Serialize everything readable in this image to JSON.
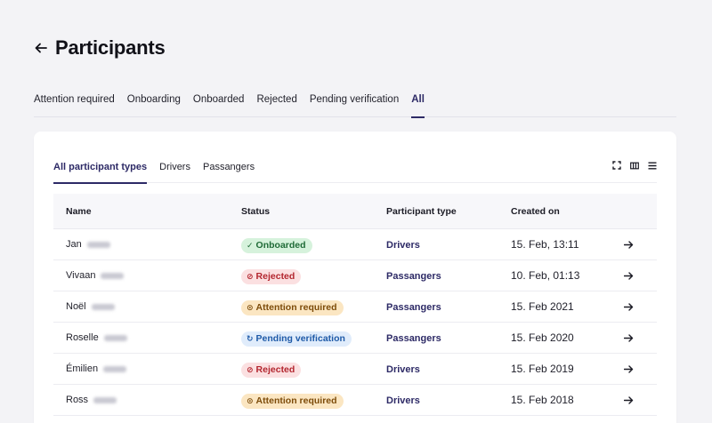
{
  "page": {
    "title": "Participants"
  },
  "tabs": [
    {
      "label": "Attention required",
      "active": false
    },
    {
      "label": "Onboarding",
      "active": false
    },
    {
      "label": "Onboarded",
      "active": false
    },
    {
      "label": "Rejected",
      "active": false
    },
    {
      "label": "Pending verification",
      "active": false
    },
    {
      "label": "All",
      "active": true
    }
  ],
  "subtabs": [
    {
      "label": "All participant types",
      "active": true
    },
    {
      "label": "Drivers",
      "active": false
    },
    {
      "label": "Passangers",
      "active": false
    }
  ],
  "toolbar_icons": [
    "fullscreen-icon",
    "columns-icon",
    "density-icon"
  ],
  "table": {
    "columns": [
      "Name",
      "Status",
      "Participant type",
      "Created on"
    ],
    "rows": [
      {
        "first_name": "Jan",
        "status": "Onboarded",
        "status_kind": "green",
        "status_icon": "✓",
        "type": "Drivers",
        "created": "15. Feb, 13:11"
      },
      {
        "first_name": "Vivaan",
        "status": "Rejected",
        "status_kind": "red",
        "status_icon": "⊘",
        "type": "Passangers",
        "created": "10. Feb, 01:13"
      },
      {
        "first_name": "Noël",
        "status": "Attention required",
        "status_kind": "amber",
        "status_icon": "⊙",
        "type": "Passangers",
        "created": "15. Feb 2021"
      },
      {
        "first_name": "Roselle",
        "status": "Pending verification",
        "status_kind": "blue",
        "status_icon": "↻",
        "type": "Passangers",
        "created": "15. Feb 2020"
      },
      {
        "first_name": "Émilien",
        "status": "Rejected",
        "status_kind": "red",
        "status_icon": "⊘",
        "type": "Drivers",
        "created": "15. Feb 2019"
      },
      {
        "first_name": "Ross",
        "status": "Attention required",
        "status_kind": "amber",
        "status_icon": "⊙",
        "type": "Drivers",
        "created": "15. Feb 2018"
      }
    ]
  },
  "colors": {
    "accent": "#2d2a66",
    "page_bg": "#f3f3f6",
    "onboarded": "#d6f2dc",
    "rejected": "#fbe0e1",
    "attention": "#fbe6c2",
    "pending": "#e0ecfb"
  }
}
